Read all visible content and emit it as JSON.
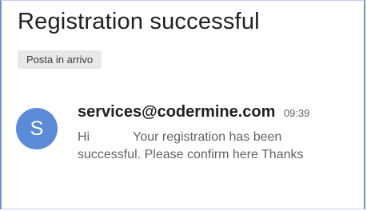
{
  "email": {
    "subject": "Registration successful",
    "label": "Posta in arrivo",
    "avatar_letter": "S",
    "sender": "services@codermine.com",
    "time": "09:39",
    "snippet_greeting": "Hi",
    "snippet_line1": "Your registration has been",
    "snippet_line2": "successful. Please confirm here Thanks"
  },
  "colors": {
    "avatar": "#5b8bd6",
    "label_chip_bg": "#e8e8e8",
    "frame_border": "#7d8cc7"
  }
}
